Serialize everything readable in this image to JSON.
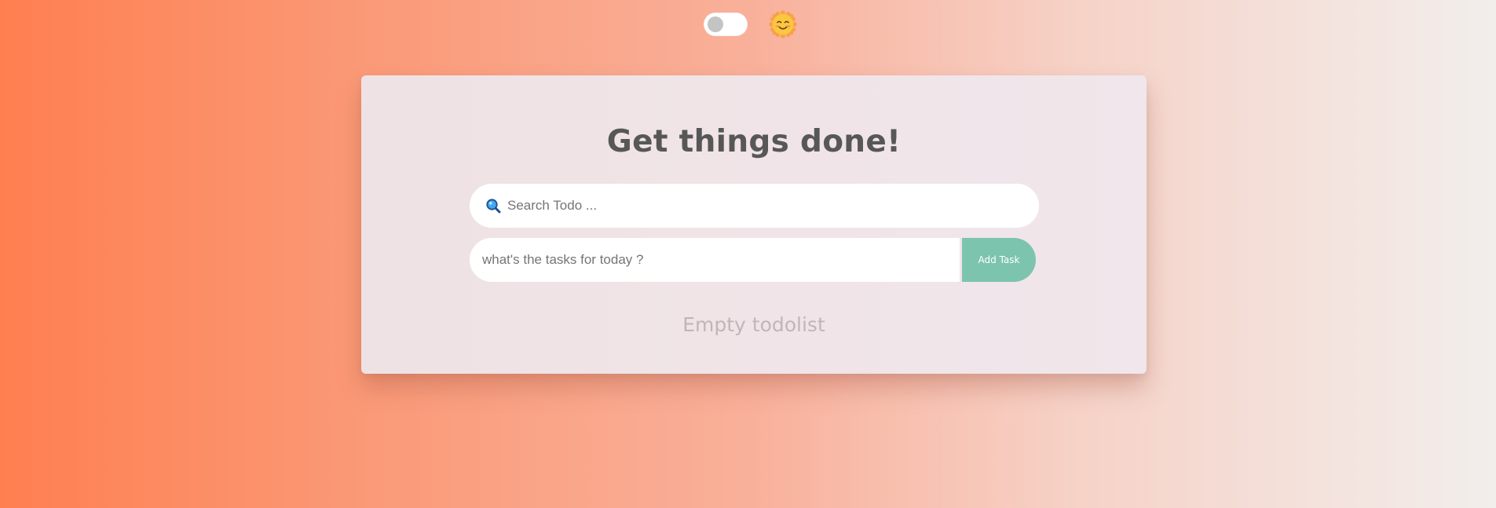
{
  "header": {
    "theme_toggle_state": "off",
    "theme_icon": "smiling-sun-icon"
  },
  "card": {
    "title": "Get things done!",
    "search": {
      "icon": "magnifier-icon",
      "placeholder": "Search Todo ...",
      "value": ""
    },
    "task_input": {
      "placeholder": "what's the tasks for today ?",
      "value": ""
    },
    "add_button_label": "Add Task",
    "empty_message": "Empty todolist"
  },
  "colors": {
    "background_start": "#ff7f50",
    "background_end": "#f2eeec",
    "card_background": "#efe2e4",
    "title": "#575757",
    "add_button": "#7cc4ae",
    "empty_text": "#c2b5b9",
    "toggle_knob": "#c4c4c4"
  }
}
